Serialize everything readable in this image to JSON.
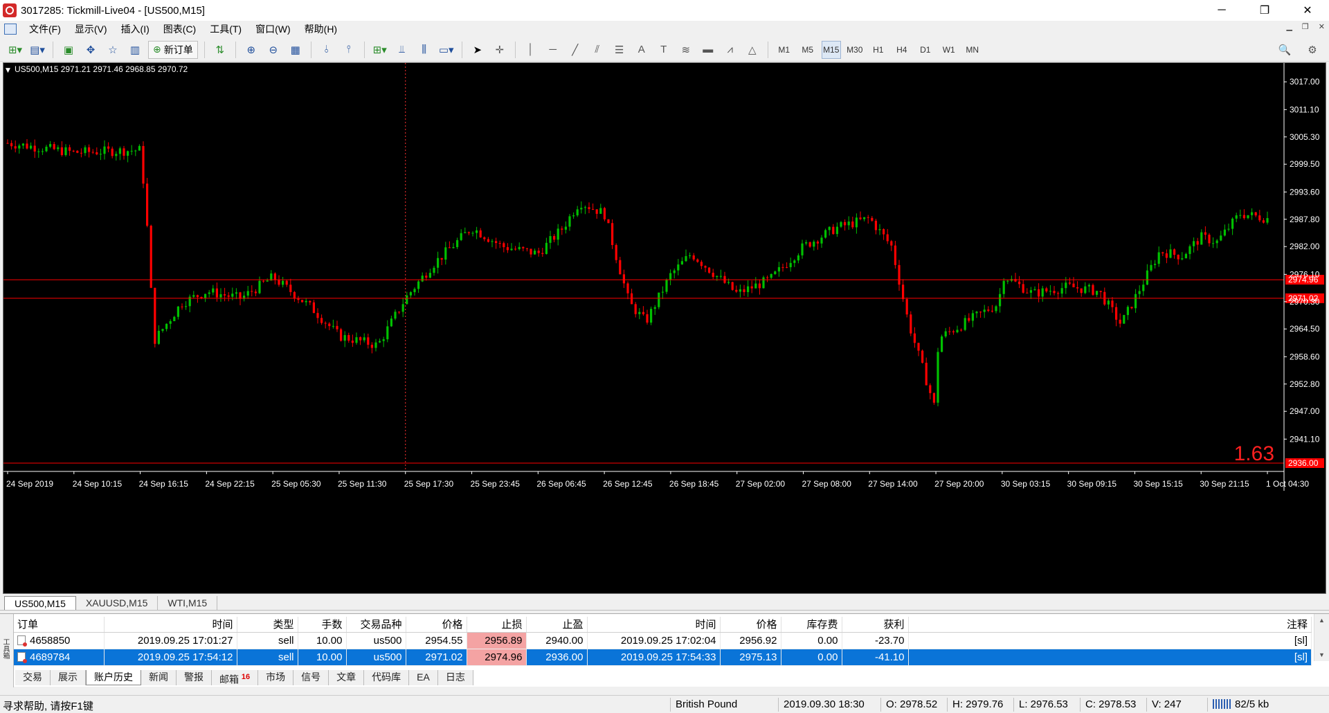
{
  "window": {
    "title": "3017285: Tickmill-Live04 - [US500,M15]",
    "controls": [
      "─",
      "❐",
      "✕"
    ]
  },
  "menu": {
    "items": [
      "文件(F)",
      "显示(V)",
      "插入(I)",
      "图表(C)",
      "工具(T)",
      "窗口(W)",
      "帮助(H)"
    ]
  },
  "toolbar": {
    "new_order_label": "新订单",
    "timeframes": [
      "M1",
      "M5",
      "M15",
      "M30",
      "H1",
      "H4",
      "D1",
      "W1",
      "MN"
    ],
    "active_timeframe": "M15"
  },
  "chart": {
    "symbol_info": "US500,M15  2971.21 2971.46 2968.85 2970.72",
    "big_label": "1.63",
    "colors": {
      "background": "#000000",
      "up": "#00c000",
      "down": "#ff0000",
      "levels": "#ff0000",
      "axis_text": "#ffffff"
    },
    "price_ticks": [
      "3017.00",
      "3011.10",
      "3005.30",
      "2999.50",
      "2993.60",
      "2987.80",
      "2982.00",
      "2976.10",
      "2970.30",
      "2964.50",
      "2958.60",
      "2952.80",
      "2947.00",
      "2941.10"
    ],
    "level_labels": [
      "2974.96",
      "2971.02",
      "2936.00"
    ],
    "time_ticks": [
      "24 Sep 2019",
      "24 Sep 10:15",
      "24 Sep 16:15",
      "24 Sep 22:15",
      "25 Sep 05:30",
      "25 Sep 11:30",
      "25 Sep 17:30",
      "25 Sep 23:45",
      "26 Sep 06:45",
      "26 Sep 12:45",
      "26 Sep 18:45",
      "27 Sep 02:00",
      "27 Sep 08:00",
      "27 Sep 14:00",
      "27 Sep 20:00",
      "30 Sep 03:15",
      "30 Sep 09:15",
      "30 Sep 15:15",
      "30 Sep 21:15",
      "1 Oct 04:30"
    ]
  },
  "chart_data": {
    "type": "candlestick",
    "symbol": "US500",
    "timeframe": "M15",
    "ylim": [
      2936.0,
      3021.0
    ],
    "horizontal_levels": [
      2974.96,
      2971.02,
      2936.0
    ],
    "vertical_marker_time": "25 Sep 17:30",
    "close_path": [
      {
        "t": "24 Sep 2019",
        "y": 3004.0
      },
      {
        "t": "24 Sep 10:15",
        "y": 3002.0
      },
      {
        "t": "24 Sep 16:15",
        "y": 3002.5
      },
      {
        "t": "24 Sep 16:45",
        "y": 2991.0
      },
      {
        "t": "24 Sep 17:30",
        "y": 2962.0
      },
      {
        "t": "24 Sep 20:00",
        "y": 2970.0
      },
      {
        "t": "24 Sep 22:15",
        "y": 2972.5
      },
      {
        "t": "25 Sep 02:00",
        "y": 2971.0
      },
      {
        "t": "25 Sep 05:30",
        "y": 2975.5
      },
      {
        "t": "25 Sep 09:00",
        "y": 2969.0
      },
      {
        "t": "25 Sep 11:30",
        "y": 2963.0
      },
      {
        "t": "25 Sep 15:00",
        "y": 2961.0
      },
      {
        "t": "25 Sep 17:30",
        "y": 2971.0
      },
      {
        "t": "25 Sep 20:00",
        "y": 2978.0
      },
      {
        "t": "25 Sep 23:45",
        "y": 2986.0
      },
      {
        "t": "26 Sep 03:00",
        "y": 2982.0
      },
      {
        "t": "26 Sep 06:45",
        "y": 2980.5
      },
      {
        "t": "26 Sep 09:00",
        "y": 2986.0
      },
      {
        "t": "26 Sep 10:30",
        "y": 2991.5
      },
      {
        "t": "26 Sep 12:45",
        "y": 2989.0
      },
      {
        "t": "26 Sep 15:00",
        "y": 2970.0
      },
      {
        "t": "26 Sep 16:30",
        "y": 2966.0
      },
      {
        "t": "26 Sep 18:45",
        "y": 2976.0
      },
      {
        "t": "26 Sep 21:00",
        "y": 2980.5
      },
      {
        "t": "27 Sep 02:00",
        "y": 2972.0
      },
      {
        "t": "27 Sep 05:00",
        "y": 2975.0
      },
      {
        "t": "27 Sep 08:00",
        "y": 2982.0
      },
      {
        "t": "27 Sep 11:00",
        "y": 2986.0
      },
      {
        "t": "27 Sep 14:00",
        "y": 2988.0
      },
      {
        "t": "27 Sep 16:00",
        "y": 2982.0
      },
      {
        "t": "27 Sep 17:30",
        "y": 2966.0
      },
      {
        "t": "27 Sep 20:00",
        "y": 2947.0
      },
      {
        "t": "27 Sep 22:00",
        "y": 2962.5
      },
      {
        "t": "30 Sep 00:30",
        "y": 2970.0
      },
      {
        "t": "30 Sep 03:15",
        "y": 2976.0
      },
      {
        "t": "30 Sep 06:00",
        "y": 2972.0
      },
      {
        "t": "30 Sep 09:15",
        "y": 2973.5
      },
      {
        "t": "30 Sep 12:00",
        "y": 2972.5
      },
      {
        "t": "30 Sep 14:00",
        "y": 2965.5
      },
      {
        "t": "30 Sep 15:15",
        "y": 2971.0
      },
      {
        "t": "30 Sep 17:30",
        "y": 2981.0
      },
      {
        "t": "30 Sep 19:30",
        "y": 2980.0
      },
      {
        "t": "30 Sep 21:15",
        "y": 2984.0
      },
      {
        "t": "30 Sep 23:00",
        "y": 2983.0
      },
      {
        "t": "1 Oct 01:30",
        "y": 2989.0
      },
      {
        "t": "1 Oct 04:30",
        "y": 2988.0
      }
    ]
  },
  "chart_tabs": [
    "US500,M15",
    "XAUUSD,M15",
    "WTI,M15"
  ],
  "orders": {
    "columns": [
      "订单",
      "时间",
      "类型",
      "手数",
      "交易品种",
      "价格",
      "止损",
      "止盈",
      "时间",
      "价格",
      "库存费",
      "获利",
      "注释"
    ],
    "rows": [
      [
        "4658850",
        "2019.09.25 17:01:27",
        "sell",
        "10.00",
        "us500",
        "2954.55",
        "2956.89",
        "2940.00",
        "2019.09.25 17:02:04",
        "2956.92",
        "0.00",
        "-23.70",
        "[sl]"
      ],
      [
        "4689784",
        "2019.09.25 17:54:12",
        "sell",
        "10.00",
        "us500",
        "2971.02",
        "2974.96",
        "2936.00",
        "2019.09.25 17:54:33",
        "2975.13",
        "0.00",
        "-41.10",
        "[sl]"
      ]
    ],
    "selected_index": 1
  },
  "terminal_side_label": "工具箱",
  "terminal_tabs": [
    "交易",
    "展示",
    "账户历史",
    "新闻",
    "警报",
    "邮箱",
    "市场",
    "信号",
    "文章",
    "代码库",
    "EA",
    "日志"
  ],
  "terminal_active_tab": "账户历史",
  "mail_badge": "16",
  "status": {
    "help": "寻求帮助, 请按F1键",
    "profile": "British Pound",
    "datetime": "2019.09.30 18:30",
    "open": "O: 2978.52",
    "high": "H: 2979.76",
    "low": "L: 2976.53",
    "close": "C: 2978.53",
    "volume": "V: 247",
    "traffic": "82/5 kb"
  }
}
